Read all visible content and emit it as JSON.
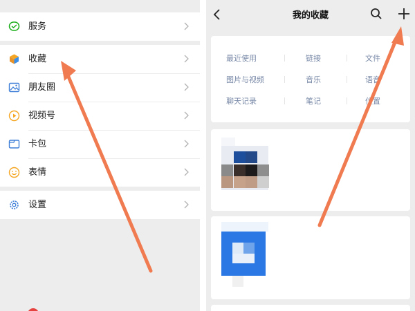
{
  "left_menu": {
    "top_item": {
      "label": "服务",
      "icon": "service-icon"
    },
    "group_items": [
      {
        "label": "收藏",
        "icon": "favorites-cube-icon"
      },
      {
        "label": "朋友圈",
        "icon": "moments-photo-icon"
      },
      {
        "label": "视频号",
        "icon": "channels-play-icon"
      },
      {
        "label": "卡包",
        "icon": "card-wallet-icon"
      },
      {
        "label": "表情",
        "icon": "sticker-smiley-icon"
      }
    ],
    "settings_item": {
      "label": "设置",
      "icon": "settings-gear-icon"
    }
  },
  "favorites": {
    "title": "我的收藏",
    "categories": [
      [
        "最近使用",
        "链接",
        "文件"
      ],
      [
        "图片与视频",
        "音乐",
        "语音"
      ],
      [
        "聊天记录",
        "笔记",
        "位置"
      ]
    ]
  },
  "colors": {
    "arrow": "#f07b51",
    "background": "#ededed",
    "category_text": "#7a8aa8",
    "service_green": "#1aad19"
  }
}
